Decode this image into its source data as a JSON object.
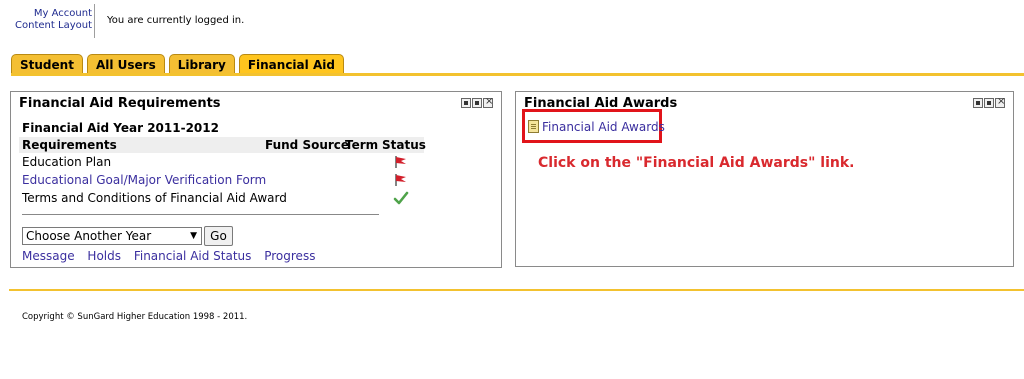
{
  "header": {
    "links": [
      "My Account",
      "Content Layout"
    ],
    "login_status": "You are currently logged in."
  },
  "tabs": [
    {
      "label": "Student",
      "active": false
    },
    {
      "label": "All Users",
      "active": false
    },
    {
      "label": "Library",
      "active": false
    },
    {
      "label": "Financial Aid",
      "active": true
    }
  ],
  "requirements_panel": {
    "title": "Financial Aid Requirements",
    "year_heading": "Financial Aid Year 2011-2012",
    "columns": [
      "Requirements",
      "Fund Source",
      "Term",
      "Status"
    ],
    "rows": [
      {
        "label": "Education Plan",
        "is_link": false,
        "status_icon": "red-flag-icon"
      },
      {
        "label": "Educational Goal/Major Verification Form",
        "is_link": true,
        "status_icon": "red-flag-icon"
      },
      {
        "label": "Terms and Conditions of Financial Aid Award",
        "is_link": false,
        "status_icon": "green-check-icon"
      }
    ],
    "year_select": {
      "value": "Choose Another Year"
    },
    "go_label": "Go",
    "bottom_links": [
      "Message",
      "Holds",
      "Financial Aid Status",
      "Progress"
    ]
  },
  "awards_panel": {
    "title": "Financial Aid Awards",
    "link_label": "Financial Aid Awards",
    "instruction": "Click on the \"Financial Aid Awards\" link."
  },
  "footer": {
    "copyright": "Copyright © SunGard Higher Education 1998 - 2011."
  },
  "colors": {
    "tab_gold": "#f4bf33",
    "link_purple": "#3b2f9f",
    "highlight_red": "#e1141a",
    "instruction_red": "#d9292e",
    "check_green": "#4fa34a"
  }
}
